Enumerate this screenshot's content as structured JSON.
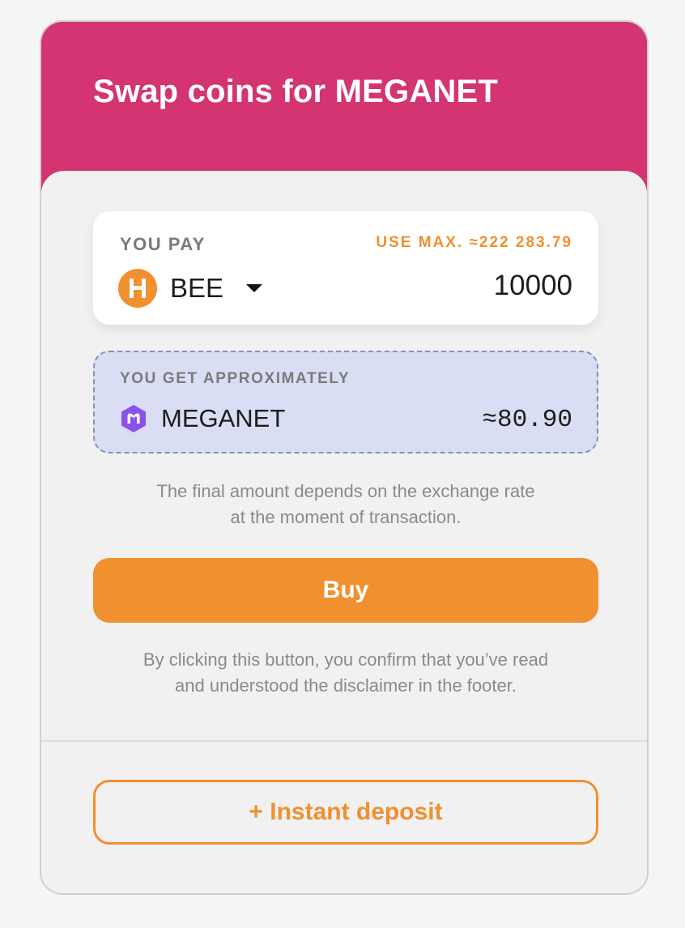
{
  "header": {
    "title": "Swap coins for MEGANET"
  },
  "colors": {
    "header_bg": "#d43472",
    "accent": "#f0902f",
    "get_box_bg": "#d9def4"
  },
  "pay": {
    "label": "YOU PAY",
    "use_max": "USE MAX. ≈222 283.79",
    "coin": "BEE",
    "coin_icon": "bee-coin-icon",
    "amount": "10000"
  },
  "get": {
    "label": "YOU GET APPROXIMATELY",
    "coin": "MEGANET",
    "coin_icon": "meganet-coin-icon",
    "amount": "≈80.90"
  },
  "note": {
    "line1": "The final amount depends on the exchange rate",
    "line2": "at the moment of transaction."
  },
  "buy_button": "Buy",
  "disclaimer": {
    "line1": "By clicking this button, you confirm that you’ve read",
    "line2": "and understood the disclaimer in the footer."
  },
  "deposit_button": "+ Instant deposit"
}
